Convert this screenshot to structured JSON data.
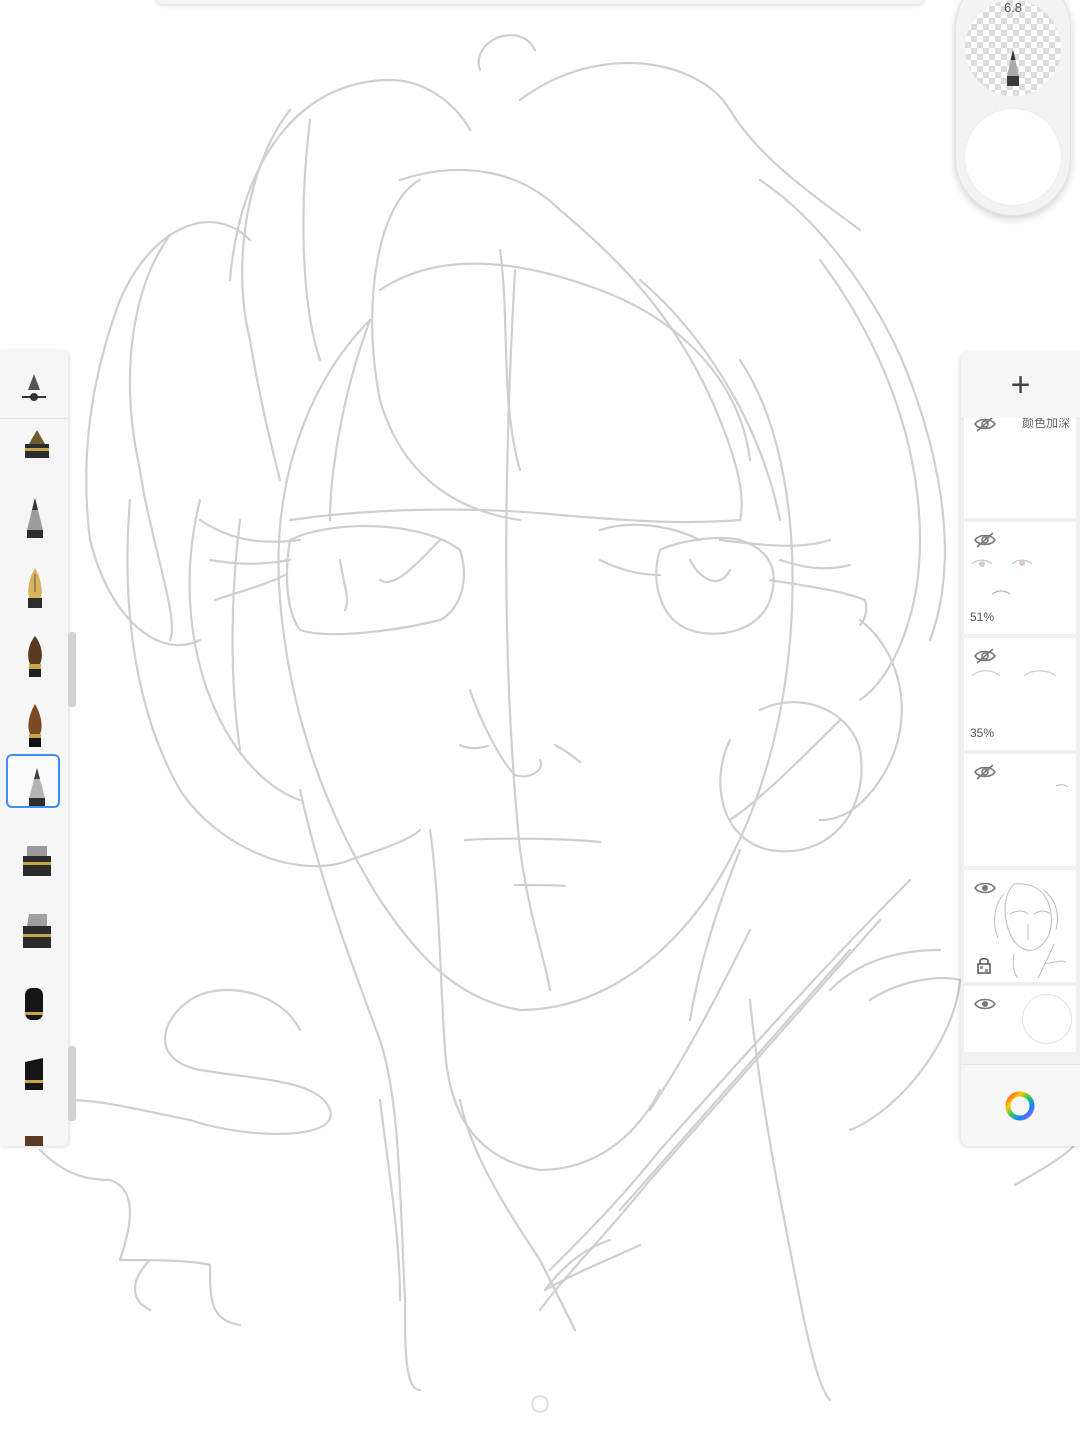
{
  "brush_puck": {
    "brush_size": "6.8",
    "icon": "brush-preview-icon"
  },
  "brush_library": {
    "items": [
      {
        "name": "pen"
      },
      {
        "name": "pencil"
      },
      {
        "name": "fountain-pen"
      },
      {
        "name": "paint-brush"
      },
      {
        "name": "ink-brush"
      },
      {
        "name": "pencil-selected",
        "selected": true
      },
      {
        "name": "marker"
      },
      {
        "name": "chisel-marker"
      },
      {
        "name": "felt-tip"
      },
      {
        "name": "pastel"
      }
    ]
  },
  "layers": {
    "add_label": "+",
    "items": [
      {
        "name": "颜色加深",
        "opacity": "",
        "visible": false
      },
      {
        "name": "",
        "opacity": "51%",
        "visible": false
      },
      {
        "name": "",
        "opacity": "35%",
        "visible": false
      },
      {
        "name": "",
        "opacity": "",
        "visible": false
      },
      {
        "name": "",
        "opacity": "",
        "visible": true,
        "locked": true
      },
      {
        "name": "",
        "opacity": "",
        "visible": true
      }
    ]
  },
  "colors": {
    "accent": "#3d8ef7",
    "sketch_line": "#c8c8c8"
  }
}
